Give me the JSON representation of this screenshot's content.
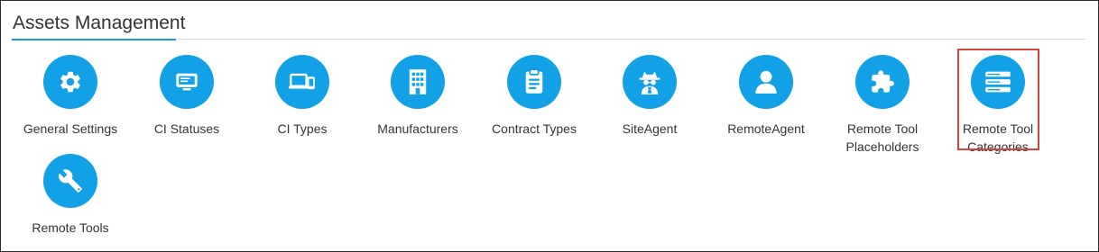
{
  "section": {
    "title": "Assets Management"
  },
  "tiles": [
    {
      "label": "General Settings",
      "icon": "gear-icon"
    },
    {
      "label": "CI Statuses",
      "icon": "monitor-icon"
    },
    {
      "label": "CI Types",
      "icon": "devices-icon"
    },
    {
      "label": "Manufacturers",
      "icon": "building-icon"
    },
    {
      "label": "Contract Types",
      "icon": "clipboard-icon"
    },
    {
      "label": "SiteAgent",
      "icon": "spy-icon"
    },
    {
      "label": "RemoteAgent",
      "icon": "user-icon"
    },
    {
      "label": "Remote Tool Placeholders",
      "icon": "puzzle-icon"
    },
    {
      "label": "Remote Tool Categories",
      "icon": "server-icon",
      "selected": true
    },
    {
      "label": "Remote Tools",
      "icon": "wrench-icon"
    }
  ],
  "colors": {
    "icon_circle": "#12a1e6",
    "accent_line": "#1a9de0",
    "selection_border": "#d9413a",
    "text": "#333333"
  }
}
